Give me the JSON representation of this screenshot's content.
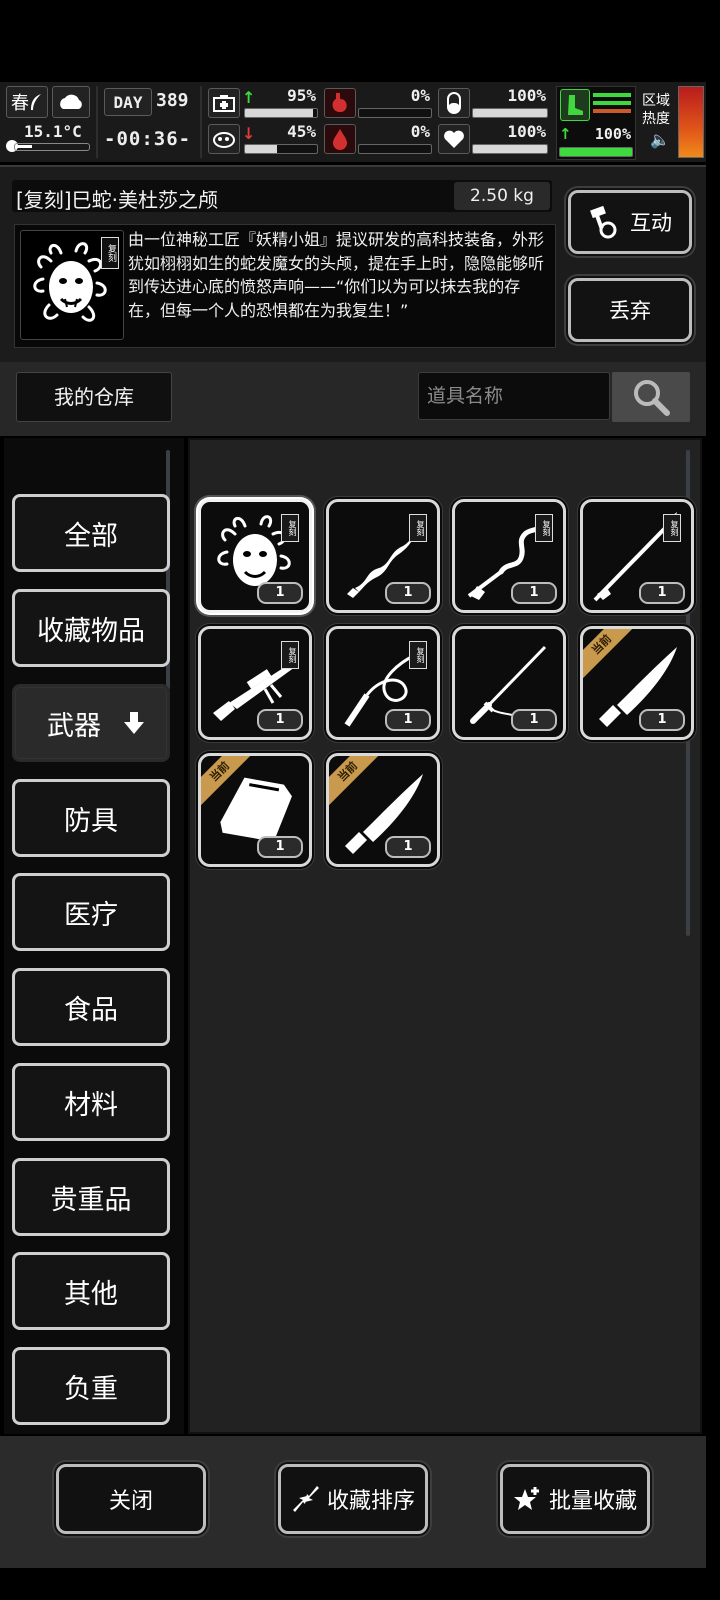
{
  "status_bar": {
    "season": "春",
    "temperature": "15.1°C",
    "day_label": "DAY",
    "day_number": "389",
    "time": "-00:36-",
    "health_pct": "95%",
    "stamina_pct": "45%",
    "hunger_pct": "0%",
    "thirst_pct": "0%",
    "hydration_pct": "100%",
    "mood_pct": "100%",
    "energy_pct": "100%",
    "health_level": 0.95,
    "stamina_level": 0.45,
    "hunger_level": 0,
    "thirst_level": 0,
    "hydration_level": 1.0,
    "mood_level": 1.0,
    "energy_level": 1.0,
    "region_label_1": "区域",
    "region_label_2": "热度",
    "up_arrow_color": "#3fd93f",
    "down_arrow_color": "#e03a3a"
  },
  "item": {
    "name": "[复刻]巳蛇·美杜莎之颅",
    "weight": "2.50 kg",
    "description": "由一位神秘工匠『妖精小姐』提议研发的高科技装备，外形犹如栩栩如生的蛇发魔女的头颅，提在手上时，隐隐能够听到传达进心底的愤怒声响——“你们以为可以抹去我的存在，但每一个人的恐惧都在为我复生！”",
    "badge": "复刻"
  },
  "actions": {
    "interact": "互动",
    "discard": "丢弃"
  },
  "warehouse": {
    "label": "我的仓库",
    "search_placeholder": "道具名称"
  },
  "categories": [
    {
      "label": "全部"
    },
    {
      "label": "收藏物品"
    },
    {
      "label": "武器",
      "active": true
    },
    {
      "label": "防具"
    },
    {
      "label": "医疗"
    },
    {
      "label": "食品"
    },
    {
      "label": "材料"
    },
    {
      "label": "贵重品"
    },
    {
      "label": "其他"
    },
    {
      "label": "负重"
    }
  ],
  "items": [
    {
      "icon": "medusa-head-icon",
      "qty": "1",
      "tag": "复刻",
      "selected": true
    },
    {
      "icon": "serpent-blade-icon",
      "qty": "1",
      "tag": "复刻"
    },
    {
      "icon": "serpent-staff-icon",
      "qty": "1",
      "tag": "复刻"
    },
    {
      "icon": "spear-icon",
      "qty": "1",
      "tag": "复刻"
    },
    {
      "icon": "sniper-rifle-icon",
      "qty": "1",
      "tag": "复刻"
    },
    {
      "icon": "whip-icon",
      "qty": "1",
      "tag": "复刻"
    },
    {
      "icon": "katana-icon",
      "qty": "1"
    },
    {
      "icon": "knife-icon",
      "qty": "1",
      "corner": "当前"
    },
    {
      "icon": "backpack-icon",
      "qty": "1",
      "corner": "当前"
    },
    {
      "icon": "knife-icon",
      "qty": "1",
      "corner": "当前"
    }
  ],
  "bottom": {
    "close": "关闭",
    "sort": "收藏排序",
    "batch": "批量收藏"
  }
}
